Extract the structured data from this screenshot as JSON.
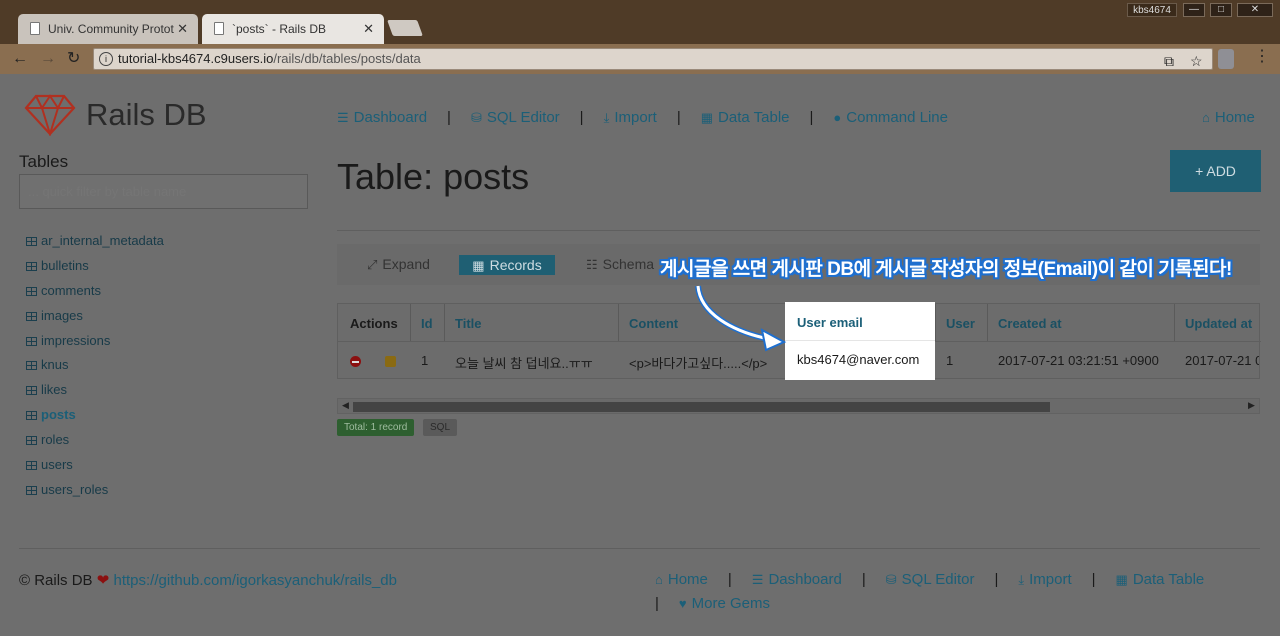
{
  "browser": {
    "tabs": [
      {
        "title": "Univ. Community Protot"
      },
      {
        "title": "`posts` - Rails DB"
      }
    ],
    "user_badge": "kbs4674",
    "url_host": "tutorial-kbs4674.c9users.io",
    "url_path": "/rails/db/tables/posts/data"
  },
  "brand": {
    "name": "Rails DB",
    "accent": "#c0392b"
  },
  "nav": {
    "dashboard": "Dashboard",
    "sql_editor": "SQL Editor",
    "import": "Import",
    "data_table": "Data Table",
    "command_line": "Command Line",
    "home": "Home",
    "separator": "|"
  },
  "sidebar": {
    "heading": "Tables",
    "filter_placeholder": "... quick filter by table name",
    "tables": [
      "ar_internal_metadata",
      "bulletins",
      "comments",
      "images",
      "impressions",
      "knus",
      "likes",
      "posts",
      "roles",
      "users",
      "users_roles"
    ],
    "active": "posts"
  },
  "main": {
    "title": "Table: posts",
    "add_button": "+ ADD",
    "subnav": {
      "expand": "Expand",
      "records": "Records",
      "schema": "Schema"
    },
    "annotation": "게시글을 쓰면 게시판 DB에 게시글 작성자의 정보(Email)이 같이 기록된다!",
    "columns": [
      "Actions",
      "Id",
      "Title",
      "Content",
      "User email",
      "User",
      "Created at",
      "Updated at"
    ],
    "row": {
      "id": "1",
      "title": "오늘 날씨 참 덥네요..ㅠㅠ",
      "content": "<p>바다가고싶다.....</p>",
      "user_email": "kbs4674@naver.com",
      "user": "1",
      "created_at": "2017-07-21 03:21:51 +0900",
      "updated_at": "2017-07-21 0"
    },
    "total_badge": "Total: 1 record",
    "sql_badge": "SQL"
  },
  "footer": {
    "copyright": "© Rails DB",
    "github": "https://github.com/igorkasyanchuk/rails_db",
    "more_gems": "More Gems",
    "home": "Home",
    "dashboard": "Dashboard",
    "sql_editor": "SQL Editor",
    "import": "Import",
    "data_table": "Data Table",
    "separator": "|"
  }
}
